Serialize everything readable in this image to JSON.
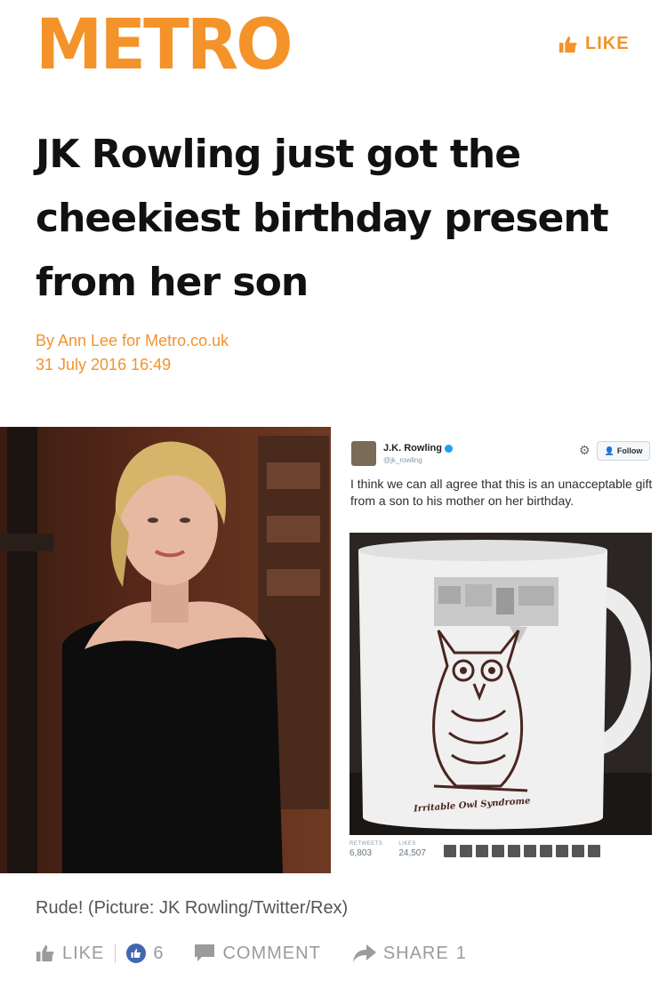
{
  "brand": {
    "logo": "METRO",
    "accent": "#F3932A",
    "like_label": "LIKE"
  },
  "article": {
    "headline": "JK Rowling just got the cheekiest birthday present from her son",
    "byline": "By Ann Lee for Metro.co.uk",
    "date": "31 July 2016 16:49"
  },
  "tweet": {
    "name": "J.K. Rowling",
    "handle": "@jk_rowling",
    "follow_label": "Follow",
    "text": "I think we can all agree that this is an unacceptable gift from a son to his mother on her birthday.",
    "mug_text": "Irritable Owl Syndrome",
    "retweets_label": "RETWEETS",
    "retweets": "6,803",
    "likes_label": "LIKES",
    "likes": "24,507"
  },
  "caption": "Rude! (Picture: JK Rowling/Twitter/Rex)",
  "actions": {
    "like_label": "LIKE",
    "like_count": "6",
    "comment_label": "COMMENT",
    "share_label": "SHARE",
    "share_count": "1"
  }
}
